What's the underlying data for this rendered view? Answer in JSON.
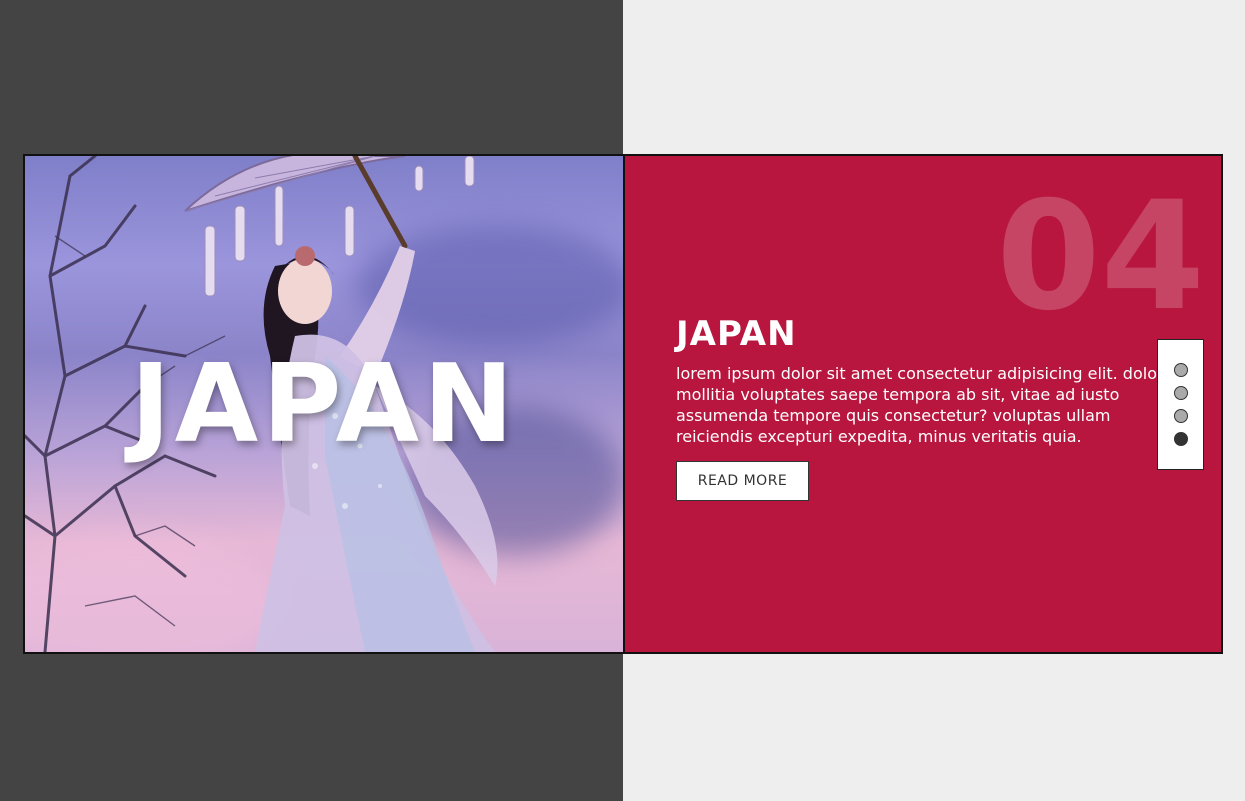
{
  "slide": {
    "hero_title": "JAPAN",
    "number": "04",
    "title": "JAPAN",
    "description": "lorem ipsum dolor sit amet consectetur adipisicing elit. dolor mollitia voluptates saepe tempora ab sit, vitae ad iusto assumenda tempore quis consectetur? voluptas ullam reiciendis excepturi expedita, minus veritatis quia.",
    "read_more_label": "READ MORE"
  },
  "pagination": {
    "count": 4,
    "active_index": 3
  },
  "colors": {
    "page_left": "#444444",
    "page_right": "#eeeeee",
    "accent": "#b8163e"
  }
}
